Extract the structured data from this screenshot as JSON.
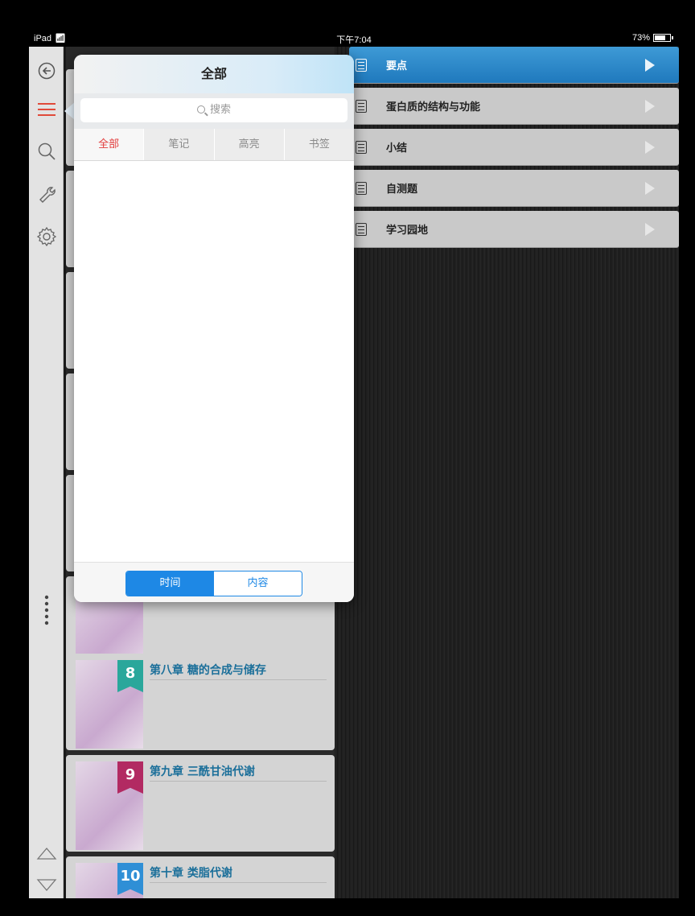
{
  "status": {
    "device": "iPad",
    "time": "下午7:04",
    "battery": "73%",
    "battery_level": 0.73
  },
  "toolbar": {
    "icons": [
      "back-icon",
      "menu-icon",
      "search-icon",
      "wrench-icon",
      "gear-icon",
      "more-dots-icon",
      "up-arrow-icon",
      "down-arrow-icon"
    ]
  },
  "sections": [
    {
      "label": "要点",
      "active": true
    },
    {
      "label": "蛋白质的结构与功能",
      "active": false
    },
    {
      "label": "小结",
      "active": false
    },
    {
      "label": "自测题",
      "active": false
    },
    {
      "label": "学习园地",
      "active": false
    }
  ],
  "chapters": [
    {
      "num": "8",
      "title": "第八章 糖的合成与储存",
      "color": "#2aa79b"
    },
    {
      "num": "9",
      "title": "第九章 三酰甘油代谢",
      "color": "#b22a62"
    },
    {
      "num": "10",
      "title": "第十章 类脂代谢",
      "color": "#2f8fd6"
    }
  ],
  "popover": {
    "title": "全部",
    "search_placeholder": "搜索",
    "tabs": [
      "全部",
      "笔记",
      "高亮",
      "书签"
    ],
    "selected_tab": "全部",
    "sort_options": [
      "时间",
      "内容"
    ],
    "selected_sort": "时间"
  }
}
